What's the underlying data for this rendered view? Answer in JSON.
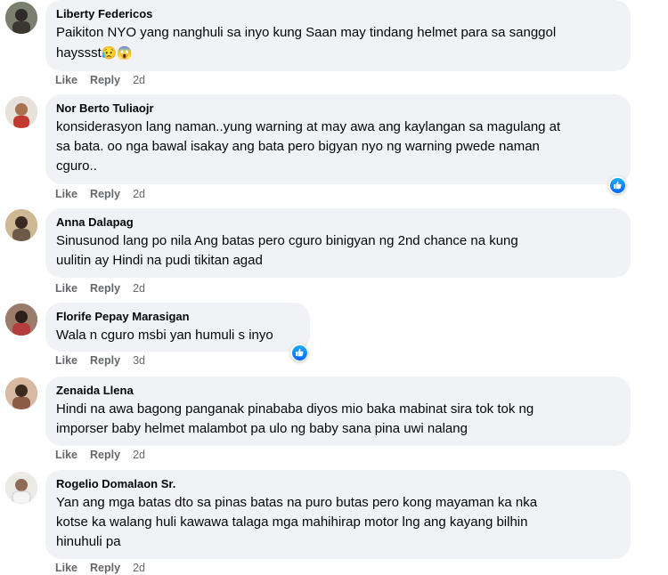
{
  "comments": [
    {
      "name": "Liberty Federicos",
      "lines": [
        "Paikiton NYO yang nanghuli sa inyo kung Saan may tindang helmet para sa sanggol",
        "hayssst"
      ],
      "emojis": "😥😱",
      "like": "Like",
      "reply": "Reply",
      "time": "2d"
    },
    {
      "name": "Nor Berto Tuliaojr",
      "lines": [
        "konsiderasyon lang naman..yung warning at may awa ang kaylangan sa magulang at",
        "sa bata. oo nga bawal isakay ang bata pero bigyan nyo ng warning pwede naman",
        "cguro.."
      ],
      "like": "Like",
      "reply": "Reply",
      "time": "2d"
    },
    {
      "name": "Anna Dalapag",
      "lines": [
        "Sinusunod lang po nila Ang batas pero cguro binigyan ng 2nd chance na kung",
        "uulitin ay Hindi na pudi tikitan agad"
      ],
      "like": "Like",
      "reply": "Reply",
      "time": "2d"
    },
    {
      "name": "Florife Pepay Marasigan",
      "lines": [
        "Wala n cguro msbi yan humuli s inyo"
      ],
      "like": "Like",
      "reply": "Reply",
      "time": "3d"
    },
    {
      "name": "Zenaida Llena",
      "lines": [
        "Hindi na awa bagong panganak pinababa diyos mio baka mabinat sira tok tok ng",
        "imporser baby helmet malambot pa ulo ng baby sana pina uwi nalang"
      ],
      "like": "Like",
      "reply": "Reply",
      "time": "2d"
    },
    {
      "name": "Rogelio Domalaon Sr.",
      "lines": [
        "Yan ang mga batas dto sa pinas batas na puro butas pero kong mayaman ka nka",
        "kotse ka walang huli kawawa talaga mga mahihirap motor lng ang kayang bilhin",
        "hinuhuli pa"
      ],
      "like": "Like",
      "reply": "Reply",
      "time": "2d"
    }
  ],
  "colors": {
    "bubble": "#f0f2f5",
    "meta": "#65676b",
    "like_blue": "#0866ff"
  }
}
